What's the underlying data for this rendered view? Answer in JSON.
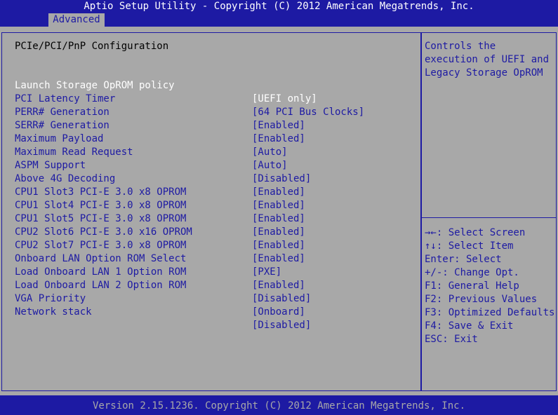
{
  "header": {
    "title": "Aptio Setup Utility - Copyright (C) 2012 American Megatrends, Inc."
  },
  "tabs": [
    {
      "label": "Advanced",
      "active": true
    }
  ],
  "main": {
    "section_title": "PCIe/PCI/PnP Configuration",
    "settings": [
      {
        "label": "Launch Storage OpROM policy",
        "value": "[UEFI only]"
      },
      {
        "label": "PCI Latency Timer",
        "value": "[64 PCI Bus Clocks]"
      },
      {
        "label": "PERR# Generation",
        "value": "[Enabled]"
      },
      {
        "label": "SERR# Generation",
        "value": "[Enabled]"
      },
      {
        "label": "Maximum Payload",
        "value": "[Auto]"
      },
      {
        "label": "Maximum Read Request",
        "value": "[Auto]"
      },
      {
        "label": "ASPM Support",
        "value": "[Disabled]"
      },
      {
        "label": "Above 4G Decoding",
        "value": "[Enabled]"
      },
      {
        "label": "CPU1 Slot3 PCI-E 3.0 x8 OPROM",
        "value": "[Enabled]"
      },
      {
        "label": "CPU1 Slot4 PCI-E 3.0 x8 OPROM",
        "value": "[Enabled]"
      },
      {
        "label": "CPU1 Slot5 PCI-E 3.0 x8 OPROM",
        "value": "[Enabled]"
      },
      {
        "label": "CPU2 Slot6 PCI-E 3.0 x16 OPROM",
        "value": "[Enabled]"
      },
      {
        "label": "CPU2 Slot7 PCI-E 3.0 x8 OPROM",
        "value": "[Enabled]"
      },
      {
        "label": "Onboard LAN Option ROM Select",
        "value": "[PXE]"
      },
      {
        "label": "Load Onboard LAN 1 Option ROM",
        "value": "[Enabled]"
      },
      {
        "label": "Load Onboard LAN 2 Option ROM",
        "value": "[Disabled]"
      },
      {
        "label": "VGA Priority",
        "value": "[Onboard]"
      },
      {
        "label": "Network stack",
        "value": "[Disabled]"
      }
    ]
  },
  "help": {
    "lines": [
      "Controls the",
      "execution of UEFI and",
      "Legacy Storage OpROM"
    ]
  },
  "keys": {
    "lines": [
      "→←: Select Screen",
      "↑↓: Select Item",
      "Enter: Select",
      "+/-: Change Opt.",
      "F1: General Help",
      "F2: Previous Values",
      "F3: Optimized Defaults",
      "F4: Save & Exit",
      "ESC: Exit"
    ]
  },
  "footer": {
    "text": "Version 2.15.1236. Copyright (C) 2012 American Megatrends, Inc."
  },
  "colors": {
    "background_blue": "#1d1aa3",
    "panel_gray": "#a8a8a8",
    "selected_text": "#ffffff",
    "option_text": "#1d1aa3"
  }
}
